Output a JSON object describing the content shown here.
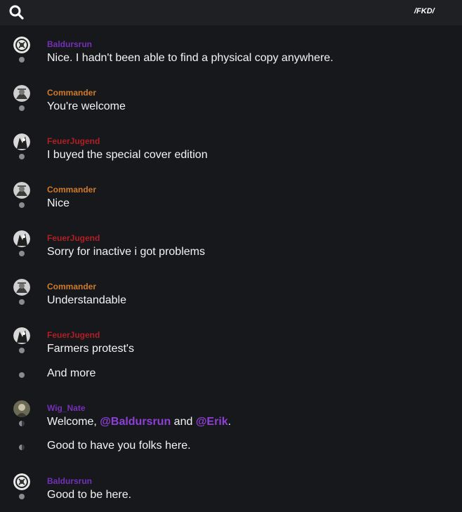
{
  "header": {
    "search_icon": "search-icon",
    "channel_label": "/FKD/"
  },
  "colors": {
    "background": "#17181b",
    "topbar": "#1f2023",
    "author_purple": "#7430b8",
    "author_orange": "#cf7a2a",
    "author_red": "#b01f25",
    "mention": "#8f3fd8"
  },
  "messages": [
    {
      "author": "Baldursrun",
      "lines": [
        "Nice. I hadn't been able to find a physical copy anywhere."
      ]
    },
    {
      "author": "Commander",
      "lines": [
        "You're welcome"
      ]
    },
    {
      "author": "FeuerJugend",
      "lines": [
        "I buyed the special cover edition"
      ]
    },
    {
      "author": "Commander",
      "lines": [
        "Nice"
      ]
    },
    {
      "author": "FeuerJugend",
      "lines": [
        "Sorry for inactive i got problems"
      ]
    },
    {
      "author": "Commander",
      "lines": [
        "Understandable"
      ]
    },
    {
      "author": "FeuerJugend",
      "lines": [
        "Farmers protest's",
        "And more"
      ]
    },
    {
      "author": "Wig_Nate",
      "welcome_line": {
        "prefix": "Welcome, ",
        "mention_1": "@Baldursrun",
        "middle": " and ",
        "mention_2": "@Erik",
        "suffix": "."
      },
      "lines": [
        "Good to have you folks here."
      ]
    },
    {
      "author": "Baldursrun",
      "lines": [
        "Good to be here."
      ]
    }
  ]
}
